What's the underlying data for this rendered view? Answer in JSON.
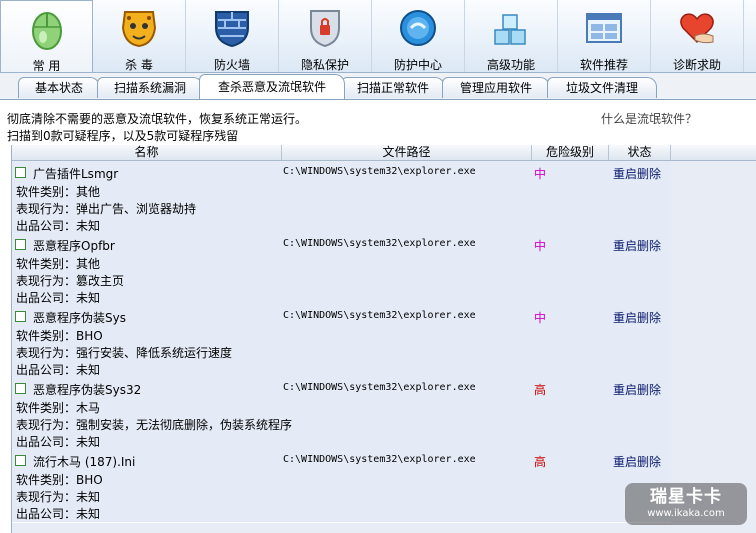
{
  "toolbar": {
    "items": [
      {
        "label": "常 用",
        "icon": "mouse-icon"
      },
      {
        "label": "杀 毒",
        "icon": "leopard-icon"
      },
      {
        "label": "防火墙",
        "icon": "firewall-icon"
      },
      {
        "label": "隐私保护",
        "icon": "lock-shield-icon"
      },
      {
        "label": "防护中心",
        "icon": "globe-icon"
      },
      {
        "label": "高级功能",
        "icon": "cubes-icon"
      },
      {
        "label": "软件推荐",
        "icon": "windows-icon"
      },
      {
        "label": "诊断求助",
        "icon": "heart-hand-icon"
      }
    ]
  },
  "tabs": [
    "基本状态",
    "扫描系统漏洞",
    "查杀恶意及流氓软件",
    "扫描正常软件",
    "管理应用软件",
    "垃圾文件清理"
  ],
  "description": "彻底清除不需要的恶意及流氓软件，恢复系统正常运行。",
  "help_link": "什么是流氓软件？",
  "summary": "扫描到0款可疑程序，以及5款可疑程序残留",
  "columns": {
    "name": "名称",
    "path": "文件路径",
    "risk": "危险级别",
    "status": "状态"
  },
  "rows": [
    {
      "name": "广告插件Lsmgr",
      "path": "C:\\WINDOWS\\system32\\explorer.exe",
      "risk": "中",
      "action": "重启删除",
      "type": "软件类别：其他",
      "behavior": "表现行为：弹出广告、浏览器劫持",
      "company": "出品公司：未知"
    },
    {
      "name": "恶意程序Opfbr",
      "path": "C:\\WINDOWS\\system32\\explorer.exe",
      "risk": "中",
      "action": "重启删除",
      "type": "软件类别：其他",
      "behavior": "表现行为：篡改主页",
      "company": "出品公司：未知"
    },
    {
      "name": "恶意程序伪装Sys",
      "path": "C:\\WINDOWS\\system32\\explorer.exe",
      "risk": "中",
      "action": "重启删除",
      "type": "软件类别：BHO",
      "behavior": "表现行为：强行安装、降低系统运行速度",
      "company": "出品公司：未知"
    },
    {
      "name": "恶意程序伪装Sys32",
      "path": "C:\\WINDOWS\\system32\\explorer.exe",
      "risk": "高",
      "action": "重启删除",
      "type": "软件类别：木马",
      "behavior": "表现行为：强制安装，无法彻底删除，伪装系统程序",
      "company": "出品公司：未知"
    },
    {
      "name": "流行木马 (187).Ini",
      "path": "C:\\WINDOWS\\system32\\explorer.exe",
      "risk": "高",
      "action": "重启删除",
      "type": "软件类别：BHO",
      "behavior": "表现行为：未知",
      "company": "出品公司：未知"
    }
  ],
  "colors": {
    "risk_medium": "#cc00cc",
    "risk_high": "#cc0000",
    "action": "#0a1a6e"
  },
  "watermark": {
    "line1": "瑞星卡卡",
    "line2": "www.ikaka.com"
  }
}
